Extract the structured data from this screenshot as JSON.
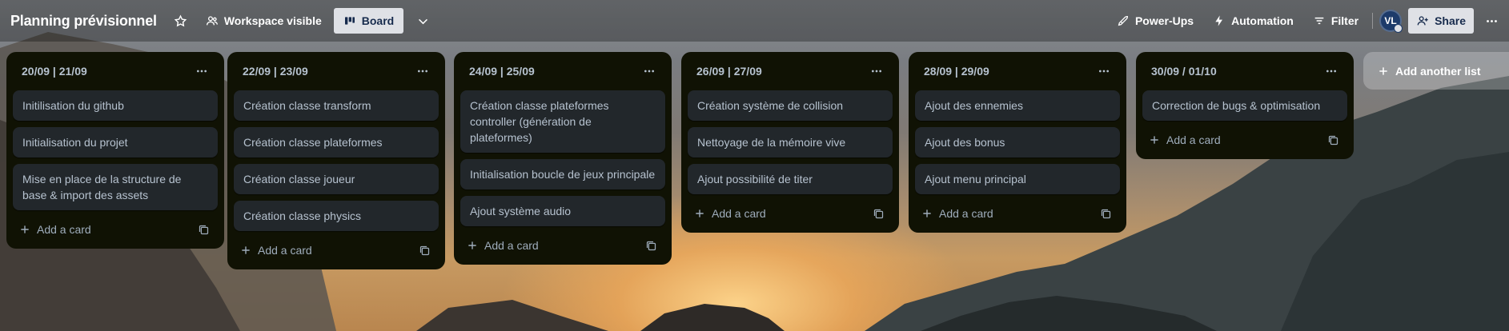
{
  "board": {
    "title": "Planning prévisionnel",
    "visibility_label": "Workspace visible",
    "view_label": "Board"
  },
  "header_right": {
    "powerups_label": "Power-Ups",
    "automation_label": "Automation",
    "filter_label": "Filter",
    "avatar_initials": "VL",
    "share_label": "Share"
  },
  "lists": [
    {
      "title": "20/09 | 21/09",
      "cards": [
        "Initilisation du github",
        "Initialisation du projet",
        "Mise en place de la structure de base & import des assets"
      ],
      "add_label": "Add a card"
    },
    {
      "title": "22/09 | 23/09",
      "cards": [
        "Création classe transform",
        "Création classe plateformes",
        "Création classe joueur",
        "Création classe physics"
      ],
      "add_label": "Add a card"
    },
    {
      "title": "24/09 | 25/09",
      "cards": [
        "Création classe plateformes controller (génération de plateformes)",
        "Initialisation boucle de jeux principale",
        "Ajout système audio"
      ],
      "add_label": "Add a card"
    },
    {
      "title": "26/09 | 27/09",
      "cards": [
        "Création système de collision",
        "Nettoyage de la mémoire vive",
        "Ajout possibilité de titer"
      ],
      "add_label": "Add a card"
    },
    {
      "title": "28/09 | 29/09",
      "cards": [
        "Ajout des ennemies",
        "Ajout des bonus",
        "Ajout menu principal"
      ],
      "add_label": "Add a card"
    },
    {
      "title": "30/09 / 01/10",
      "cards": [
        "Correction de bugs & optimisation"
      ],
      "add_label": "Add a card"
    }
  ],
  "add_list_label": "Add another list",
  "icons": {
    "star": "star-icon",
    "visibility": "people-icon",
    "board_view": "board-icon",
    "chevron": "chevron-down-icon",
    "powerups": "rocket-icon",
    "automation": "lightning-icon",
    "filter": "filter-icon",
    "share": "add-person-icon",
    "more": "more-icon",
    "list_menu": "ellipsis-icon",
    "add": "plus-icon",
    "template": "template-icon"
  },
  "colors": {
    "list_bg": "#101204",
    "card_bg": "#22272b",
    "text": "#b6c2cf",
    "header_button_bg": "#dfe1e6"
  }
}
